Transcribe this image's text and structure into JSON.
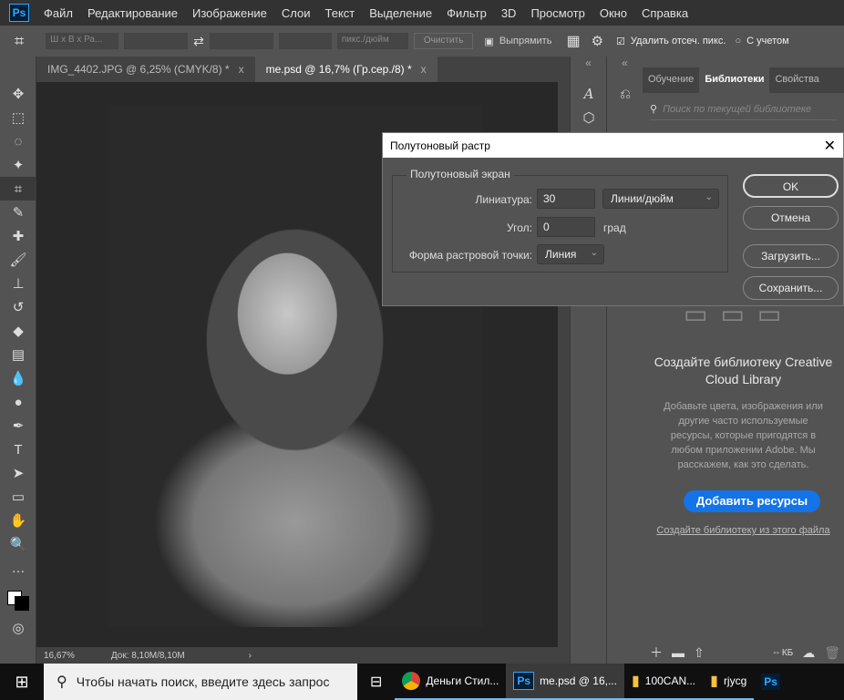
{
  "menu": [
    "Файл",
    "Редактирование",
    "Изображение",
    "Слои",
    "Текст",
    "Выделение",
    "Фильтр",
    "3D",
    "Просмотр",
    "Окно",
    "Справка"
  ],
  "app_logo": "Ps",
  "options": {
    "ratio": "Ш x В x Ра...",
    "units": "пикс./дюйм",
    "clear": "Очистить",
    "straighten": "Выпрямить",
    "delete_cropped": "Удалить отсеч. пикс.",
    "content_aware": "С учетом"
  },
  "tabs": [
    {
      "label": "IMG_4402.JPG @ 6,25% (CMYK/8) *",
      "close": "x"
    },
    {
      "label": "me.psd @ 16,7% (Гр.сер./8) *",
      "close": "x"
    }
  ],
  "status": {
    "zoom": "16,67%",
    "doc": "Док: 8,10M/8,10M"
  },
  "panel": {
    "tabs": [
      "Обучение",
      "Библиотеки",
      "Свойства"
    ],
    "search_placeholder": "Поиск по текущей библиотеке",
    "title": "Создайте библиотеку Creative Cloud Library",
    "description": "Добавьте цвета, изображения или другие часто используемые ресурсы, которые пригодятся в любом приложении Adobe. Мы расскажем, как это сделать.",
    "add_button": "Добавить ресурсы",
    "create_link": "Создайте библиотеку из этого файла",
    "size": "-- КБ"
  },
  "dialog": {
    "title": "Полутоновый растр",
    "group": "Полутоновый экран",
    "frequency_label": "Линиатура:",
    "frequency_value": "30",
    "frequency_unit": "Линии/дюйм",
    "angle_label": "Угол:",
    "angle_value": "0",
    "angle_unit": "град",
    "shape_label": "Форма растровой точки:",
    "shape_value": "Линия",
    "ok": "OK",
    "cancel": "Отмена",
    "load": "Загрузить...",
    "save": "Сохранить..."
  },
  "taskbar": {
    "search": "Чтобы начать поиск, введите здесь запрос",
    "items": [
      "Деньги Стил...",
      "me.psd @ 16,...",
      "100CAN...",
      "rjycg"
    ]
  }
}
